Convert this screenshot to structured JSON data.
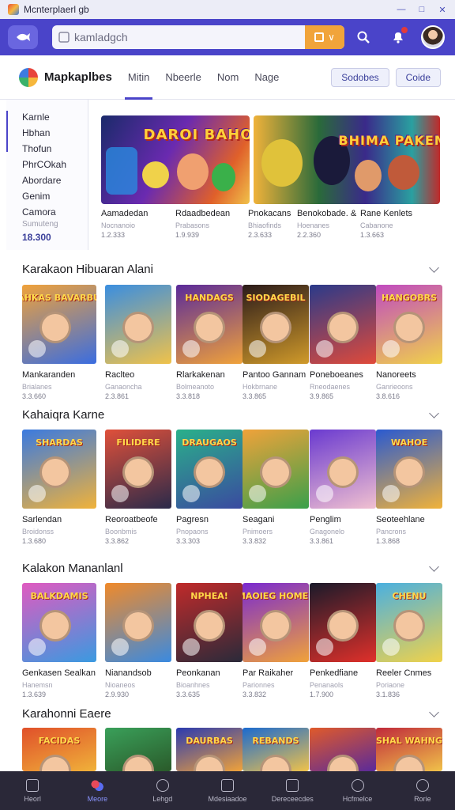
{
  "window": {
    "title": "Mcnterplaerl gb",
    "controls": [
      "minimize",
      "maximize",
      "close"
    ]
  },
  "appbar": {
    "search_placeholder": "kamladgch",
    "icons": [
      "fish-logo-icon",
      "search-icon",
      "notification-icon",
      "avatar"
    ]
  },
  "header": {
    "brand": "Mapkaplbes",
    "tabs": [
      "Mitin",
      "Nbeerle",
      "Nom",
      "Nage"
    ],
    "active_tab": 0,
    "buttons": [
      "Sodobes",
      "Coide"
    ]
  },
  "side_panel": {
    "items": [
      "Karnle",
      "Hbhan",
      "Thofun",
      "PhrCOkah",
      "Abordare",
      "Genim",
      "Camora"
    ],
    "small": "Sumuteng",
    "price": "18.300"
  },
  "banner": {
    "art_titles": [
      "DAROI BAHOS",
      "BHIMA PAKEMUS"
    ],
    "items": [
      {
        "title": "Aamadedan",
        "sub": "Nocnanoio",
        "price": "1.2.333"
      },
      {
        "title": "Rdaadbedean",
        "sub": "Prabasons",
        "price": "1.9.939"
      },
      {
        "title": "Pnokacans",
        "sub": "Bhiaofinds",
        "price": "2.3.633"
      },
      {
        "title": "Benokobade. &",
        "sub": "Hoenanes",
        "price": "2.2.360"
      },
      {
        "title": "Rane Kenlets",
        "sub": "Cabanone",
        "price": "1.3.663"
      }
    ]
  },
  "sections": [
    {
      "title": "Karakaon Hibuaran Alani",
      "items": [
        {
          "name": "Mankaranden",
          "sub": "Brialanes",
          "price": "3.3.660",
          "art": "PAHKAS BAVARBUS",
          "colors": [
            "#f0a23a",
            "#3a6de0"
          ]
        },
        {
          "name": "Raclteo",
          "sub": "Ganaoncha",
          "price": "2.3.861",
          "art": "",
          "colors": [
            "#3a8ee0",
            "#f0c24a"
          ]
        },
        {
          "name": "Rlarkakenan",
          "sub": "Bolmeanoto",
          "price": "3.3.818",
          "art": "HANDAGS",
          "colors": [
            "#5a2a9a",
            "#f0a23a"
          ]
        },
        {
          "name": "Pantoo Gannam",
          "sub": "Hokbrnane",
          "price": "3.3.865",
          "art": "SIODAGEBIL",
          "colors": [
            "#2a1a1a",
            "#d09a2a"
          ]
        },
        {
          "name": "Poneboeanes",
          "sub": "Rneodaenes",
          "price": "3.9.865",
          "art": "",
          "colors": [
            "#2a3a8a",
            "#e04a3a"
          ]
        },
        {
          "name": "Nanoreets",
          "sub": "Ganrieoons",
          "price": "3.8.616",
          "art": "HANGOBRS",
          "colors": [
            "#c04ac0",
            "#f0d24a"
          ]
        }
      ]
    },
    {
      "title": "Kahaiqra Karne",
      "items": [
        {
          "name": "Sarlendan",
          "sub": "Broidonss",
          "price": "1.3.680",
          "art": "SHARDAS",
          "colors": [
            "#3a7ae0",
            "#f0b23a"
          ]
        },
        {
          "name": "Reoroatbeofe",
          "sub": "Boonbmis",
          "price": "3.3.862",
          "art": "FILIDERE",
          "colors": [
            "#e0503a",
            "#2a2a4a"
          ]
        },
        {
          "name": "Pagresn",
          "sub": "Pnopaons",
          "price": "3.3.303",
          "art": "DRAUGAOS",
          "colors": [
            "#2ab08a",
            "#3a4aa0"
          ]
        },
        {
          "name": "Seagani",
          "sub": "Pnimoers",
          "price": "3.3.832",
          "art": "",
          "colors": [
            "#f0a23a",
            "#3aa04a"
          ]
        },
        {
          "name": "Penglim",
          "sub": "Gnagonelo",
          "price": "3.3.861",
          "art": "",
          "colors": [
            "#6a3ad0",
            "#f0c0d0"
          ]
        },
        {
          "name": "Seoteehlane",
          "sub": "Pancrons",
          "price": "1.3.868",
          "art": "WAHOE",
          "colors": [
            "#2a5ad0",
            "#f0b23a"
          ]
        }
      ]
    },
    {
      "title": "Kalakon Mananlanl",
      "items": [
        {
          "name": "Genkasen Sealkan",
          "sub": "Hanemsn",
          "price": "1.3.639",
          "art": "BALKDAMIS",
          "colors": [
            "#e05ac0",
            "#3a9ae0"
          ]
        },
        {
          "name": "Nianandsob",
          "sub": "Nioaneos",
          "price": "2.9.930",
          "art": "",
          "colors": [
            "#f08a2a",
            "#3a8ae0"
          ]
        },
        {
          "name": "Peonkanan",
          "sub": "Bioanhnes",
          "price": "3.3.635",
          "art": "NPHEA!",
          "colors": [
            "#c02a2a",
            "#2a2a3a"
          ]
        },
        {
          "name": "Par Raikaher",
          "sub": "Parionnes",
          "price": "3.3.832",
          "art": "MAOIEG HOMES",
          "colors": [
            "#7a2ad0",
            "#f0a23a"
          ]
        },
        {
          "name": "Penkedfiane",
          "sub": "Penanaols",
          "price": "1.7.900",
          "art": "",
          "colors": [
            "#1a1a2a",
            "#e0302a"
          ]
        },
        {
          "name": "Reeler Cnmes",
          "sub": "Poriaone",
          "price": "3.1.836",
          "art": "CHENU",
          "colors": [
            "#4ab0e0",
            "#f0d24a"
          ]
        }
      ]
    },
    {
      "title": "Karahonni Eaere",
      "items": [
        {
          "name": "",
          "sub": "",
          "price": "",
          "art": "FACIDAS",
          "colors": [
            "#e0502a",
            "#f0b23a"
          ]
        },
        {
          "name": "",
          "sub": "",
          "price": "",
          "art": "",
          "colors": [
            "#3aa05a",
            "#2a5a2a"
          ]
        },
        {
          "name": "",
          "sub": "",
          "price": "",
          "art": "DAURBAS",
          "colors": [
            "#2a3ab0",
            "#f0a23a"
          ]
        },
        {
          "name": "",
          "sub": "",
          "price": "",
          "art": "REBANDS",
          "colors": [
            "#1a6ad0",
            "#f0c24a"
          ]
        },
        {
          "name": "",
          "sub": "",
          "price": "",
          "art": "",
          "colors": [
            "#e05a2a",
            "#5a2a9a"
          ]
        },
        {
          "name": "",
          "sub": "",
          "price": "",
          "art": "SHAL WAHNG",
          "colors": [
            "#c02a3a",
            "#f0c24a"
          ]
        }
      ]
    }
  ],
  "bottom_nav": {
    "items": [
      "Heorl",
      "Meore",
      "Lehgd",
      "Mdesiaadoe",
      "Dereceecdes",
      "Hcfmelce",
      "Rorie"
    ],
    "active": 1
  }
}
